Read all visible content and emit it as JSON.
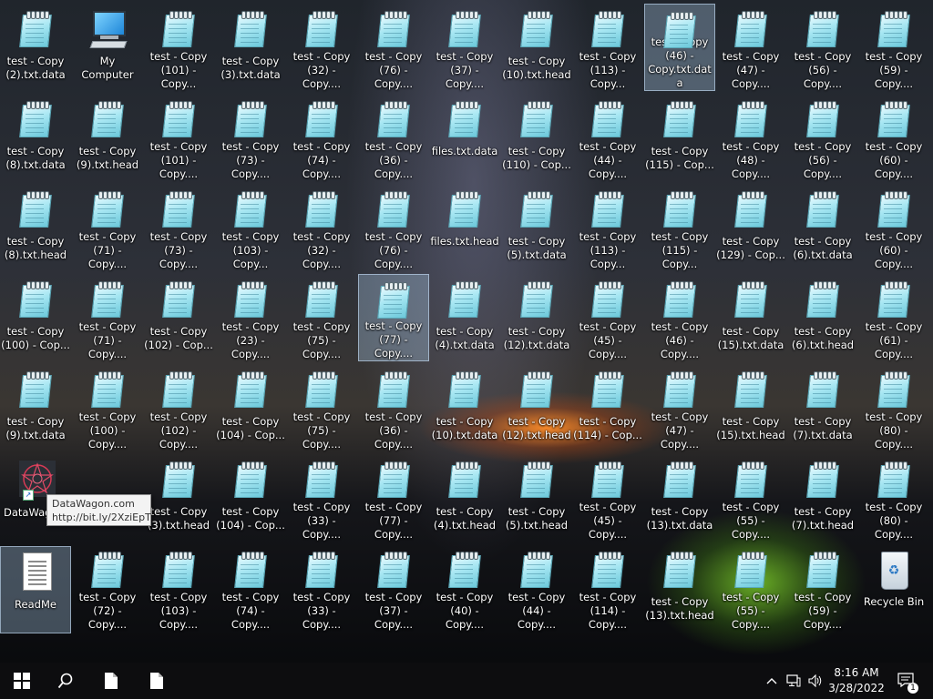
{
  "desktop": {
    "columns": [
      [
        "test - Copy (2).txt.data",
        "test - Copy (8).txt.data",
        "test - Copy (8).txt.head",
        "test - Copy (100) - Cop...",
        "test - Copy (9).txt.data",
        "",
        ""
      ],
      [
        "My Computer",
        "test - Copy (9).txt.head",
        "test - Copy (71) - Copy....",
        "test - Copy (71) - Copy....",
        "test - Copy (100) - Copy....",
        "",
        "test - Copy (72) - Copy...."
      ],
      [
        "test - Copy (101) - Copy...",
        "test - Copy (101) - Copy....",
        "test - Copy (73) - Copy....",
        "test - Copy (102) - Cop...",
        "test - Copy (102) - Copy....",
        "test - Copy (3).txt.head",
        "test - Copy (103) - Copy...."
      ],
      [
        "test - Copy (3).txt.data",
        "test - Copy (73) - Copy....",
        "test - Copy (103) - Copy...",
        "test - Copy (23) - Copy....",
        "test - Copy (104) - Cop...",
        "test - Copy (104) - Cop...",
        "test - Copy (74) - Copy...."
      ],
      [
        "test - Copy (32) - Copy....",
        "test - Copy (74) - Copy....",
        "test - Copy (32) - Copy....",
        "test - Copy (75) - Copy....",
        "test - Copy (75) - Copy....",
        "test - Copy (33) - Copy....",
        "test - Copy (33) - Copy...."
      ],
      [
        "test - Copy (76) - Copy....",
        "test - Copy (36) - Copy....",
        "test - Copy (76) - Copy....",
        "test - Copy (77) - Copy....",
        "test - Copy (36) - Copy....",
        "test - Copy (77) - Copy....",
        "test - Copy (37) - Copy...."
      ],
      [
        "test - Copy (37) - Copy....",
        "files.txt.data",
        "files.txt.head",
        "test - Copy (4).txt.data",
        "test - Copy (10).txt.data",
        "test - Copy (4).txt.head",
        "test - Copy (40) - Copy...."
      ],
      [
        "test - Copy (10).txt.head",
        "test - Copy (110) - Cop...",
        "test - Copy (5).txt.data",
        "test - Copy (12).txt.data",
        "test - Copy (12).txt.head",
        "test - Copy (5).txt.head",
        "test - Copy (44) - Copy...."
      ],
      [
        "test - Copy (113) - Copy...",
        "test - Copy (44) - Copy....",
        "test - Copy (113) - Copy...",
        "test - Copy (45) - Copy....",
        "test - Copy (114) - Cop...",
        "test - Copy (45) - Copy....",
        "test - Copy (114) - Copy...."
      ],
      [
        "test - Copy (46) - Copy.txt.data",
        "test - Copy (115) - Cop...",
        "test - Copy (115) - Copy...",
        "test - Copy (46) - Copy....",
        "test - Copy (47) - Copy....",
        "test - Copy (13).txt.data",
        "test - Copy (13).txt.head"
      ],
      [
        "test - Copy (47) - Copy....",
        "test - Copy (48) - Copy....",
        "test - Copy (129) - Cop...",
        "test - Copy (15).txt.data",
        "test - Copy (15).txt.head",
        "test - Copy (55) - Copy....",
        "test - Copy (55) - Copy...."
      ],
      [
        "test - Copy (56) - Copy....",
        "test - Copy (56) - Copy....",
        "test - Copy (6).txt.data",
        "test - Copy (6).txt.head",
        "test - Copy (7).txt.data",
        "test - Copy (7).txt.head",
        "test - Copy (59) - Copy...."
      ],
      [
        "test - Copy (59) - Copy....",
        "test - Copy (60) - Copy....",
        "test - Copy (60) - Copy....",
        "test - Copy (61) - Copy....",
        "test - Copy (80) - Copy....",
        "test - Copy (80) - Copy....",
        "Recycle Bin"
      ]
    ],
    "datawagon_label": "DataWagon",
    "readme_label": "ReadMe"
  },
  "tooltip": {
    "line1": "DataWagon.com",
    "line2": "http://bit.ly/2XziEpT"
  },
  "taskbar": {
    "time": "8:16 AM",
    "date": "3/28/2022",
    "notification_count": "1"
  },
  "colors": {
    "selection": "#aac8e6",
    "taskbar": "#0d0d0f"
  }
}
